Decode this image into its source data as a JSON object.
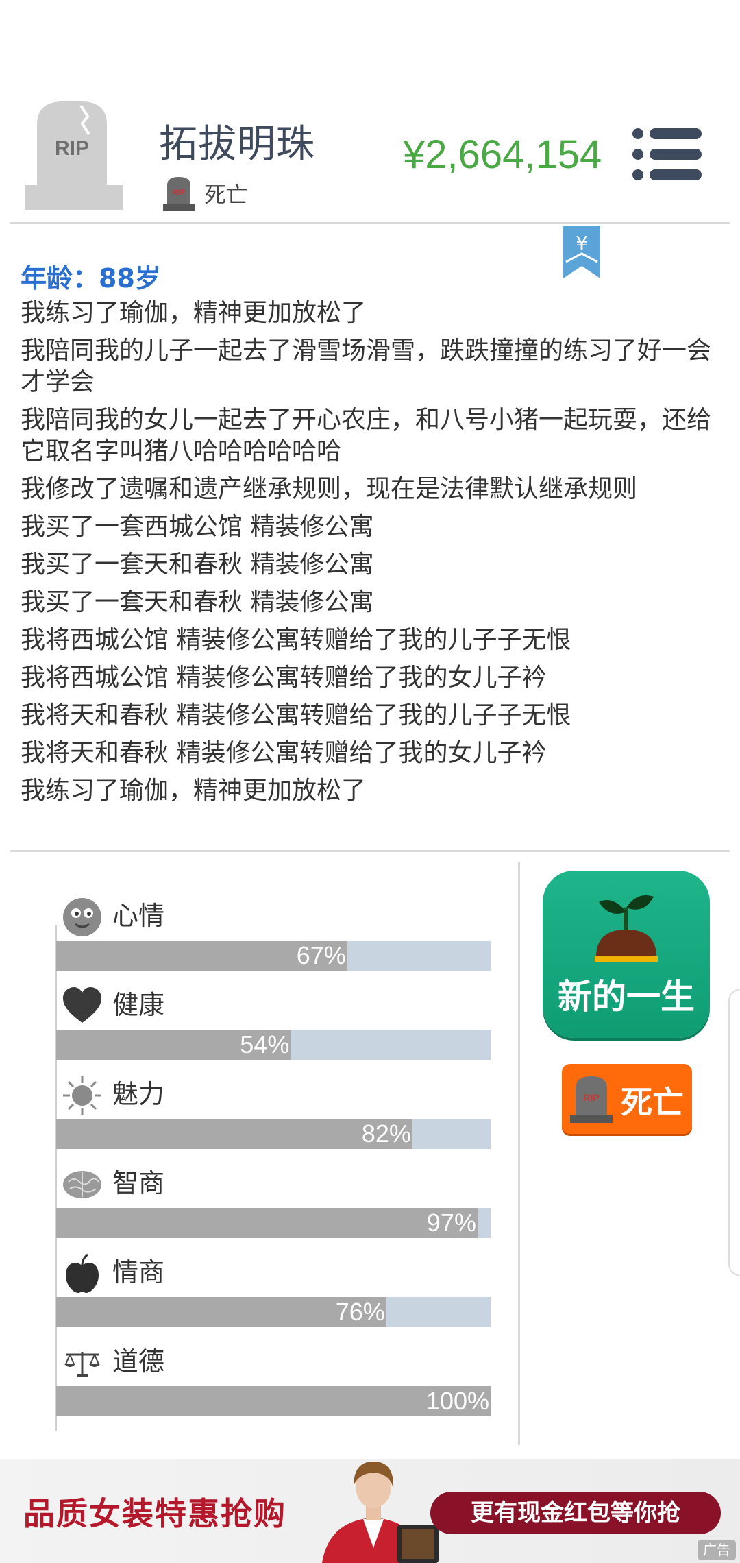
{
  "header": {
    "name": "拓拔明珠",
    "status": "死亡",
    "money": "¥2,664,154",
    "tomb_text": "RIP"
  },
  "log": {
    "age": "年龄：88岁",
    "entries": [
      "我练习了瑜伽，精神更加放松了",
      "我陪同我的儿子一起去了滑雪场滑雪，跌跌撞撞的练习了好一会才学会",
      "我陪同我的女儿一起去了开心农庄，和八号小猪一起玩耍，还给它取名字叫猪八哈哈哈哈哈哈",
      "我修改了遗嘱和遗产继承规则，现在是法律默认继承规则",
      "我买了一套西城公馆 精装修公寓",
      "我买了一套天和春秋 精装修公寓",
      "我买了一套天和春秋 精装修公寓",
      "我将西城公馆 精装修公寓转赠给了我的儿子子无恨",
      "我将西城公馆 精装修公寓转赠给了我的女儿子衿",
      "我将天和春秋 精装修公寓转赠给了我的儿子子无恨",
      "我将天和春秋 精装修公寓转赠给了我的女儿子衿",
      "我练习了瑜伽，精神更加放松了"
    ]
  },
  "stats": [
    {
      "label": "心情",
      "value": 67,
      "display": "67%",
      "icon": "face-icon"
    },
    {
      "label": "健康",
      "value": 54,
      "display": "54%",
      "icon": "heart-icon"
    },
    {
      "label": "魅力",
      "value": 82,
      "display": "82%",
      "icon": "sun-icon"
    },
    {
      "label": "智商",
      "value": 97,
      "display": "97%",
      "icon": "brain-icon"
    },
    {
      "label": "情商",
      "value": 76,
      "display": "76%",
      "icon": "apple-icon"
    },
    {
      "label": "道德",
      "value": 100,
      "display": "100%",
      "icon": "scale-icon"
    }
  ],
  "actions": {
    "new_life": "新的一生",
    "die": "死亡",
    "die_icon_text": "RIP"
  },
  "bookmark_symbol": "¥",
  "ad": {
    "left_text": "品质女装特惠抢购",
    "right_text": "更有现金红包等你抢",
    "tag": "广告"
  },
  "colors": {
    "money": "#4aa845",
    "age": "#2a6fd0",
    "new_life_btn": "#16a880",
    "die_btn": "#ff6a0a",
    "bar_fill": "#a9a9a9",
    "bar_track": "#c8d4df"
  }
}
